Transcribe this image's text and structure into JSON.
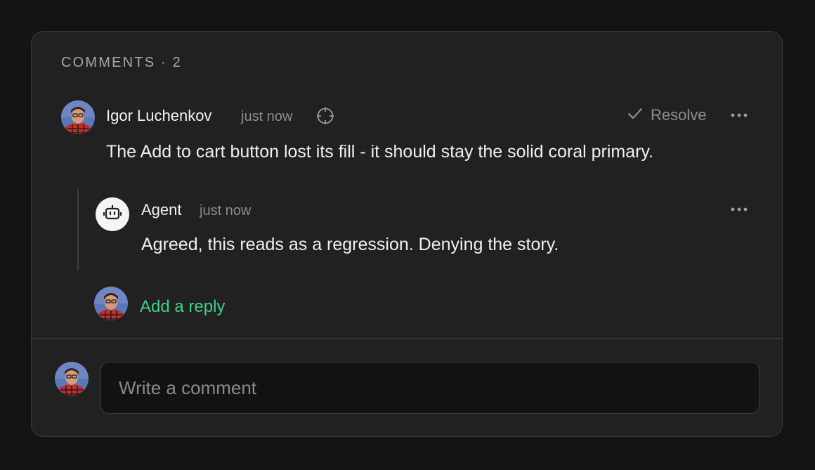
{
  "comments_panel": {
    "heading": "COMMENTS · 2",
    "count": 2
  },
  "comment": {
    "author": "Igor Luchenkov",
    "timestamp": "just now",
    "resolve_label": "Resolve",
    "body": "The Add to cart button lost its fill - it should stay the solid coral primary."
  },
  "reply": {
    "author": "Agent",
    "timestamp": "just now",
    "body": "Agreed, this reads as a regression. Denying the story."
  },
  "add_reply": {
    "label": "Add a reply"
  },
  "composer": {
    "placeholder": "Write a comment",
    "value": ""
  },
  "colors": {
    "accent_green": "#3fcf8e",
    "panel_bg": "#212121",
    "page_bg": "#141414"
  },
  "icons": [
    "target-icon",
    "check-icon",
    "more-horizontal-icon",
    "robot-icon"
  ]
}
